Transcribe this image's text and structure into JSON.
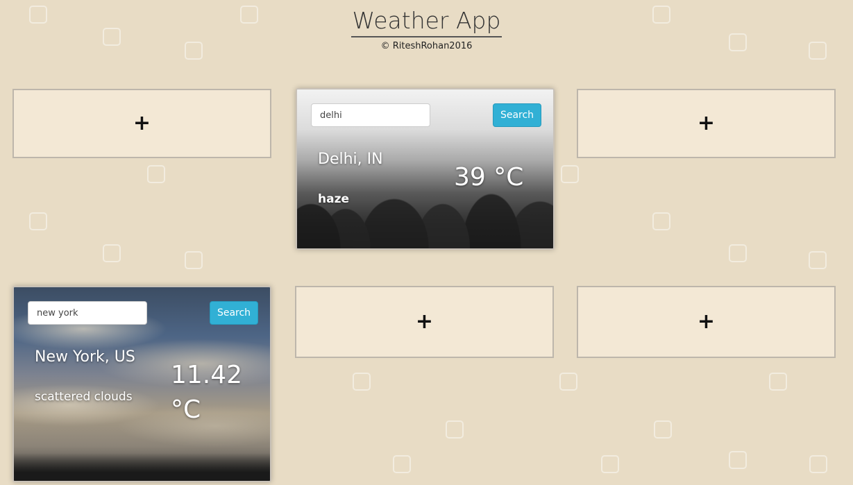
{
  "header": {
    "title": "Weather App",
    "copyright": "© RiteshRohan2016"
  },
  "empty_card": {
    "label": "+"
  },
  "cards": [
    {
      "input_value": "delhi",
      "button_label": "Search",
      "city": "Delhi, IN",
      "description": "haze",
      "temperature": "39 °C"
    },
    {
      "input_value": "new york",
      "button_label": "Search",
      "city": "New York, US",
      "description": "scattered clouds",
      "temperature": "11.42 °C"
    }
  ],
  "icons": [
    "plus-icon"
  ]
}
